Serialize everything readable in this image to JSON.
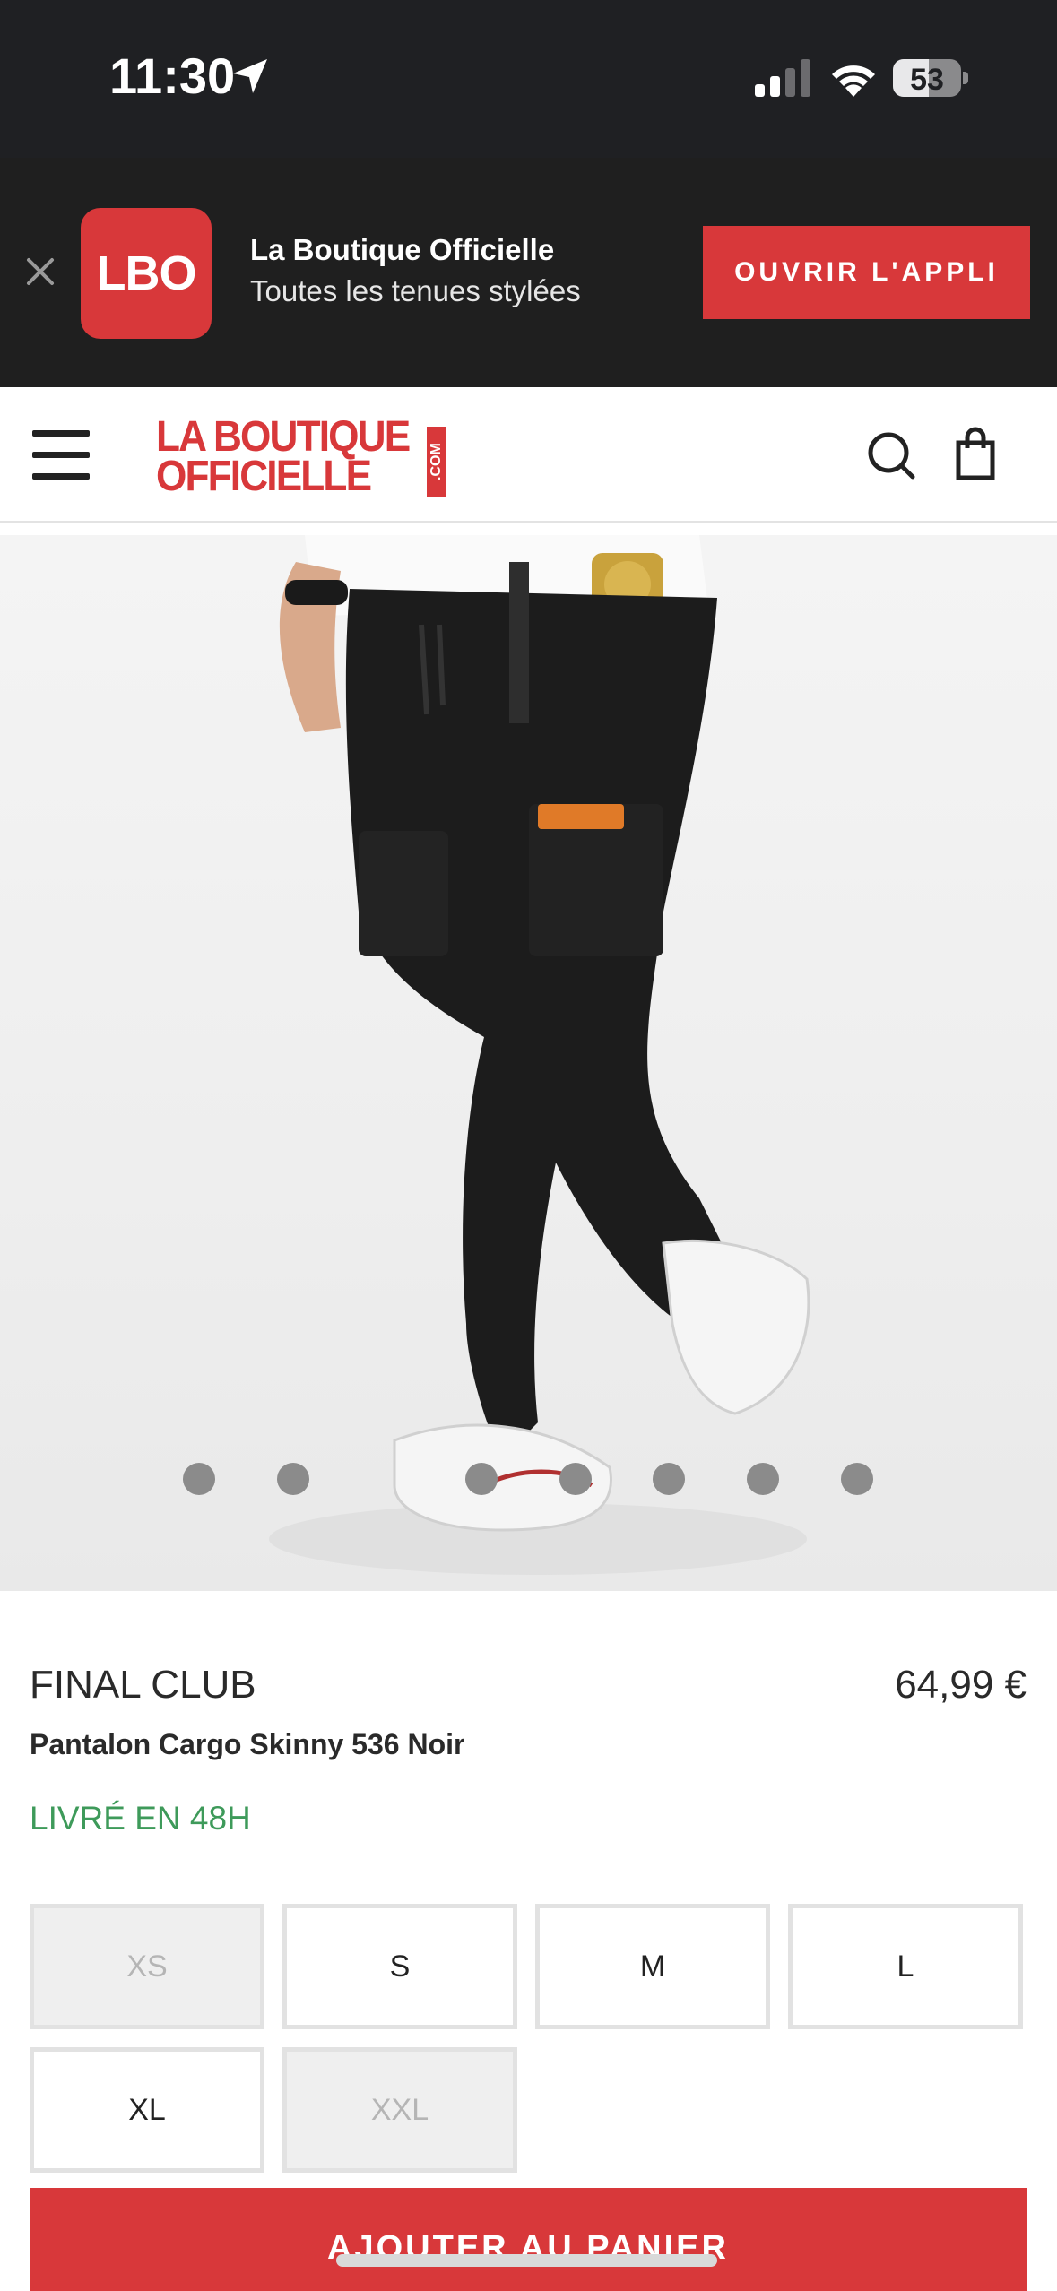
{
  "status_bar": {
    "time": "11:30",
    "battery_level": "53",
    "battery_fraction": 0.53,
    "signal_bars_active": 2,
    "signal_bars_total": 4
  },
  "app_banner": {
    "logo_text": "LBO",
    "title": "La Boutique Officielle",
    "subtitle": "Toutes les tenues stylées",
    "open_button": "OUVRIR L'APPLI",
    "accent_color": "#d8383a"
  },
  "header": {
    "logo_line1": "LA BOUTIQUE",
    "logo_line2": "OFFICIELLE",
    "logo_suffix": ".COM",
    "icons": [
      "menu-icon",
      "search-icon",
      "bag-icon"
    ]
  },
  "gallery": {
    "image_description_icon": "product-photo",
    "dot_count": 7
  },
  "product": {
    "brand": "FINAL CLUB",
    "price": "64,99 €",
    "name": "Pantalon Cargo Skinny 536 Noir",
    "delivery": "LIVRÉ EN 48H",
    "delivery_color": "#3e9a5a",
    "sizes": [
      {
        "label": "XS",
        "available": false
      },
      {
        "label": "S",
        "available": true
      },
      {
        "label": "M",
        "available": true
      },
      {
        "label": "L",
        "available": true
      },
      {
        "label": "XL",
        "available": true
      },
      {
        "label": "XXL",
        "available": false
      }
    ],
    "add_to_cart": "AJOUTER AU PANIER"
  }
}
